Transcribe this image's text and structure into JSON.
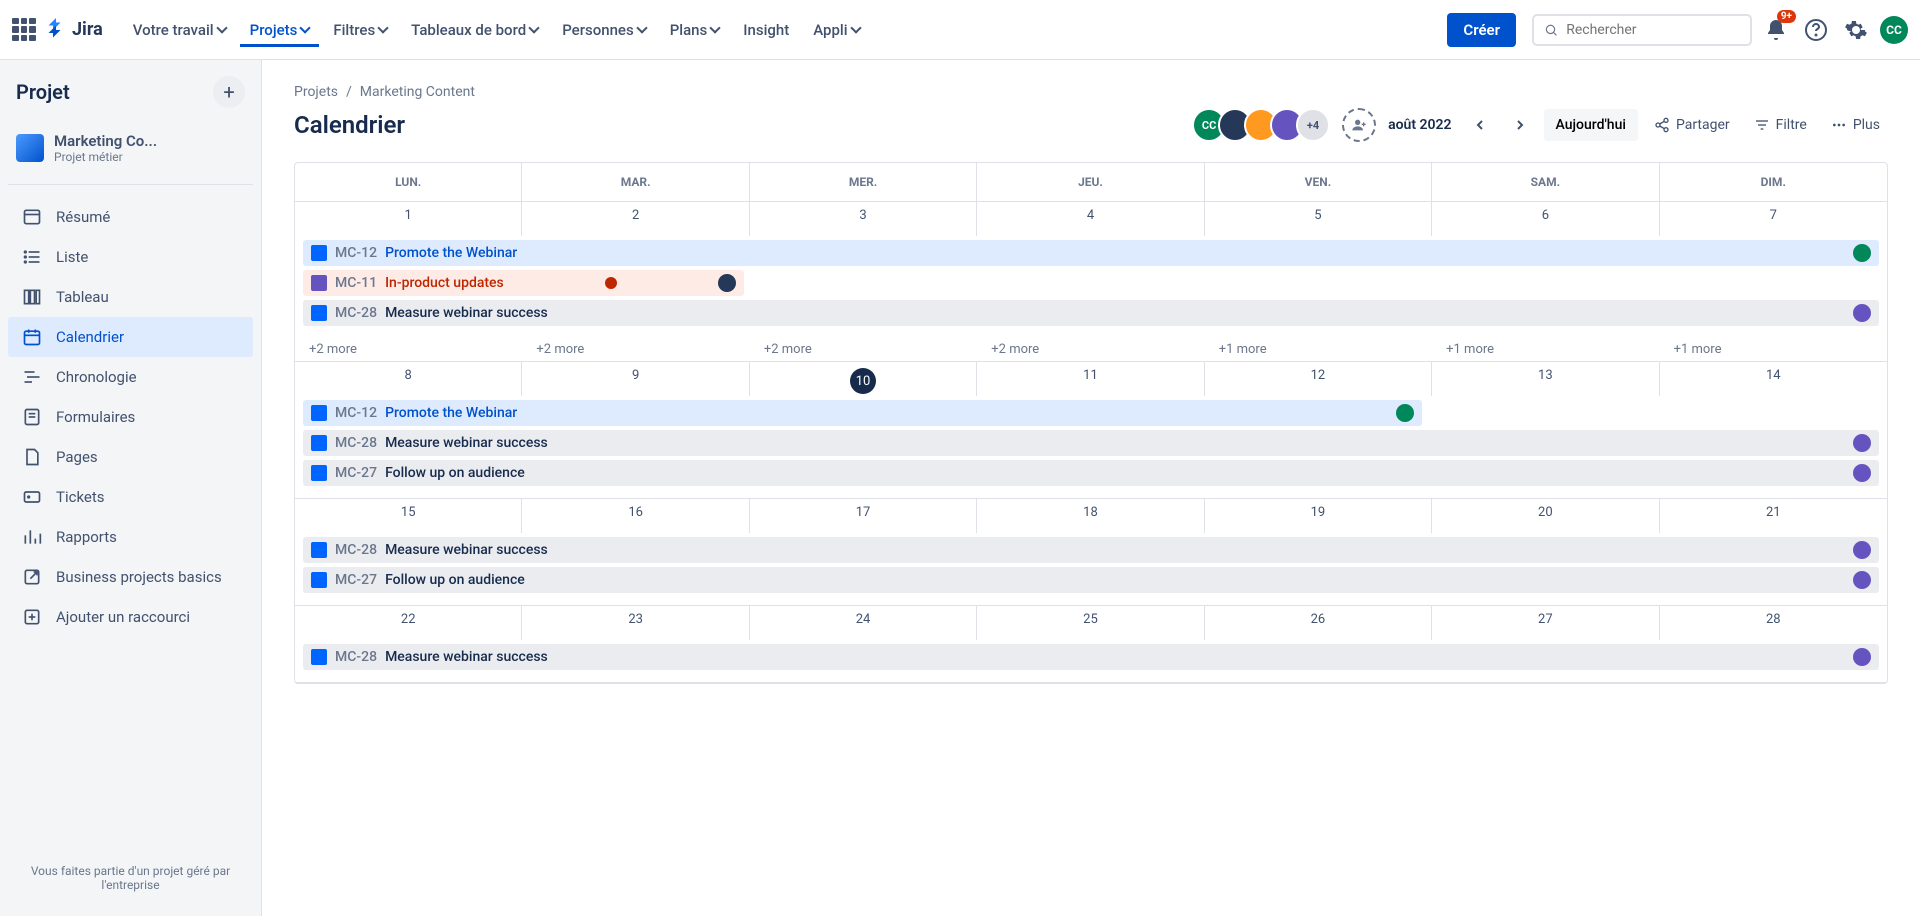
{
  "topnav": {
    "logo": "Jira",
    "items": [
      "Votre travail",
      "Projets",
      "Filtres",
      "Tableaux de bord",
      "Personnes",
      "Plans",
      "Insight",
      "Appli"
    ],
    "active_index": 1,
    "create": "Créer",
    "search_placeholder": "Rechercher",
    "notif_badge": "9+"
  },
  "sidebar": {
    "title": "Projet",
    "project_name": "Marketing Co...",
    "project_sub": "Projet métier",
    "items": [
      {
        "label": "Résumé",
        "icon": "summary"
      },
      {
        "label": "Liste",
        "icon": "list"
      },
      {
        "label": "Tableau",
        "icon": "board"
      },
      {
        "label": "Calendrier",
        "icon": "calendar"
      },
      {
        "label": "Chronologie",
        "icon": "timeline"
      },
      {
        "label": "Formulaires",
        "icon": "form"
      },
      {
        "label": "Pages",
        "icon": "page"
      },
      {
        "label": "Tickets",
        "icon": "ticket"
      },
      {
        "label": "Rapports",
        "icon": "report"
      },
      {
        "label": "Business projects basics",
        "icon": "external"
      },
      {
        "label": "Ajouter un raccourci",
        "icon": "add"
      }
    ],
    "active_index": 3,
    "footer": "Vous faites partie d'un projet géré par l'entreprise"
  },
  "breadcrumb": [
    "Projets",
    "Marketing Content"
  ],
  "page_title": "Calendrier",
  "header": {
    "avatar_more": "+4",
    "month": "août 2022",
    "today": "Aujourd'hui",
    "share": "Partager",
    "filter": "Filtre",
    "more": "Plus"
  },
  "calendar": {
    "day_headers": [
      "LUN.",
      "MAR.",
      "MER.",
      "JEU.",
      "VEN.",
      "SAM.",
      "DIM."
    ],
    "weeks": [
      {
        "days": [
          "1",
          "2",
          "3",
          "4",
          "5",
          "6",
          "7"
        ],
        "today_index": -1,
        "events": [
          {
            "type": "blue",
            "icon": "task",
            "key": "MC-12",
            "title": "Promote the Webinar",
            "avatar": "#00875A"
          },
          {
            "type": "red",
            "icon": "story",
            "key": "MC-11",
            "title": "In-product updates",
            "priority": true,
            "avatar": "#253858"
          },
          {
            "type": "grey",
            "icon": "task",
            "key": "MC-28",
            "title": "Measure webinar success",
            "avatar": "#6554C0"
          }
        ],
        "more": [
          "+2 more",
          "+2 more",
          "+2 more",
          "+2 more",
          "+1 more",
          "+1 more",
          "+1 more"
        ]
      },
      {
        "days": [
          "8",
          "9",
          "10",
          "11",
          "12",
          "13",
          "14"
        ],
        "today_index": 2,
        "events": [
          {
            "type": "blue-narrow",
            "icon": "task",
            "key": "MC-12",
            "title": "Promote the Webinar",
            "avatar": "#00875A"
          },
          {
            "type": "grey",
            "icon": "task",
            "key": "MC-28",
            "title": "Measure webinar success",
            "avatar": "#6554C0"
          },
          {
            "type": "grey",
            "icon": "task",
            "key": "MC-27",
            "title": "Follow up on audience",
            "avatar": "#6554C0"
          }
        ],
        "more": []
      },
      {
        "days": [
          "15",
          "16",
          "17",
          "18",
          "19",
          "20",
          "21"
        ],
        "today_index": -1,
        "events": [
          {
            "type": "grey",
            "icon": "task",
            "key": "MC-28",
            "title": "Measure webinar success",
            "avatar": "#6554C0"
          },
          {
            "type": "grey",
            "icon": "task",
            "key": "MC-27",
            "title": "Follow up on audience",
            "avatar": "#6554C0"
          }
        ],
        "more": []
      },
      {
        "days": [
          "22",
          "23",
          "24",
          "25",
          "26",
          "27",
          "28"
        ],
        "today_index": -1,
        "events": [
          {
            "type": "grey",
            "icon": "task",
            "key": "MC-28",
            "title": "Measure webinar success",
            "avatar": "#6554C0"
          }
        ],
        "more": []
      }
    ]
  }
}
